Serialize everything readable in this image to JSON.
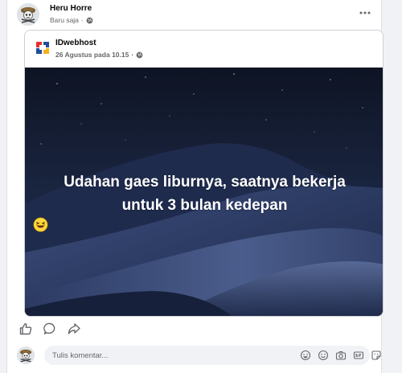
{
  "post": {
    "author": "Heru Horre",
    "time": "Baru saja",
    "separator": "·"
  },
  "shared": {
    "author": "IDwebhost",
    "time": "26 Agustus pada 10.15",
    "separator": "·",
    "text_line1": "Udahan gaes liburnya, saatnya bekerja",
    "text_line2": "untuk 3 bulan kedepan",
    "background_color": "#1e2a4a"
  },
  "actions": {
    "icons": [
      "like-icon",
      "comment-icon",
      "share-icon"
    ]
  },
  "comment": {
    "placeholder": "Tulis komentar...",
    "icons": [
      "sticker-icon",
      "emoji-icon",
      "camera-icon",
      "gif-icon",
      "sticker-pack-icon"
    ]
  },
  "colors": {
    "brand_red": "#e5322d",
    "brand_blue": "#1f4e9c",
    "secondary_text": "#65676b"
  }
}
